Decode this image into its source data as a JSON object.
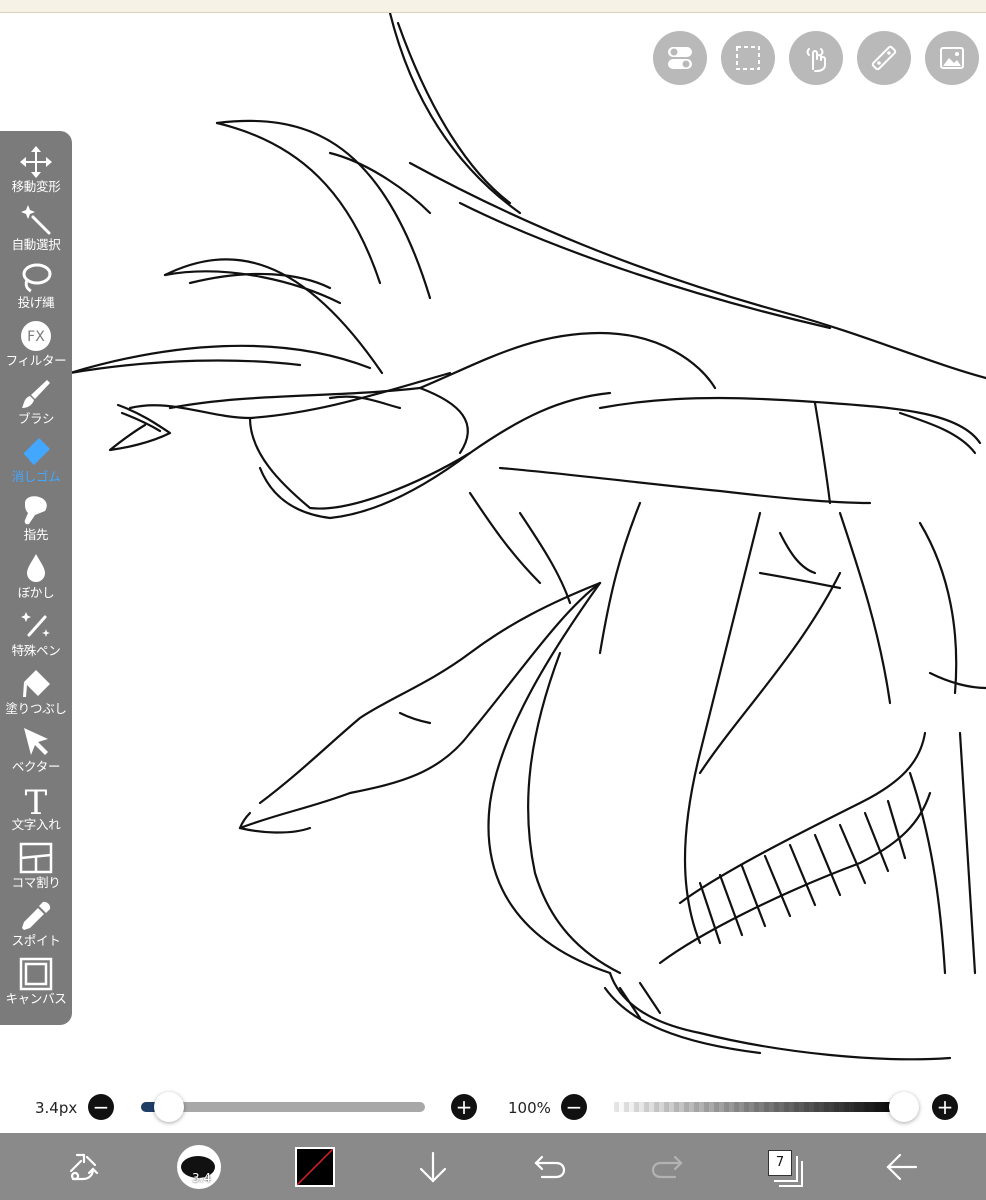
{
  "toolbar": {
    "tools": [
      {
        "label": "移動変形",
        "icon": "move-icon"
      },
      {
        "label": "自動選択",
        "icon": "magic-wand-icon"
      },
      {
        "label": "投げ縄",
        "icon": "lasso-icon"
      },
      {
        "label": "フィルター",
        "icon": "fx-filter-icon",
        "icon_text": "FX"
      },
      {
        "label": "ブラシ",
        "icon": "brush-icon"
      },
      {
        "label": "消しゴム",
        "icon": "eraser-icon",
        "active": true
      },
      {
        "label": "指先",
        "icon": "finger-icon"
      },
      {
        "label": "ぼかし",
        "icon": "blur-drop-icon"
      },
      {
        "label": "特殊ペン",
        "icon": "special-pen-icon"
      },
      {
        "label": "塗りつぶし",
        "icon": "fill-bucket-icon"
      },
      {
        "label": "ベクター",
        "icon": "vector-arrow-icon"
      },
      {
        "label": "文字入れ",
        "icon": "text-icon",
        "icon_text": "T"
      },
      {
        "label": "コマ割り",
        "icon": "frame-divider-icon"
      },
      {
        "label": "スポイト",
        "icon": "eyedropper-icon"
      },
      {
        "label": "キャンバス",
        "icon": "canvas-icon"
      }
    ],
    "active_color": "#43a7ff",
    "background": "#7b7b7b"
  },
  "top_buttons": [
    "toggle-icon",
    "selection-icon",
    "gesture-hand-icon",
    "ruler-icon",
    "image-icon"
  ],
  "slider_bar": {
    "brush_size": "3.4px",
    "brush_size_level": 0.1,
    "opacity": "100%",
    "opacity_level": 1.0,
    "minus": "−",
    "plus": "+"
  },
  "bottom_bar": {
    "brush_preview_value": "3.4",
    "layer_count": "7",
    "icons": [
      "transform-arrows-icon",
      "brush-preview",
      "color-swatch",
      "down-arrow-icon",
      "undo-icon",
      "redo-icon",
      "layers-icon",
      "back-arrow-icon"
    ]
  }
}
